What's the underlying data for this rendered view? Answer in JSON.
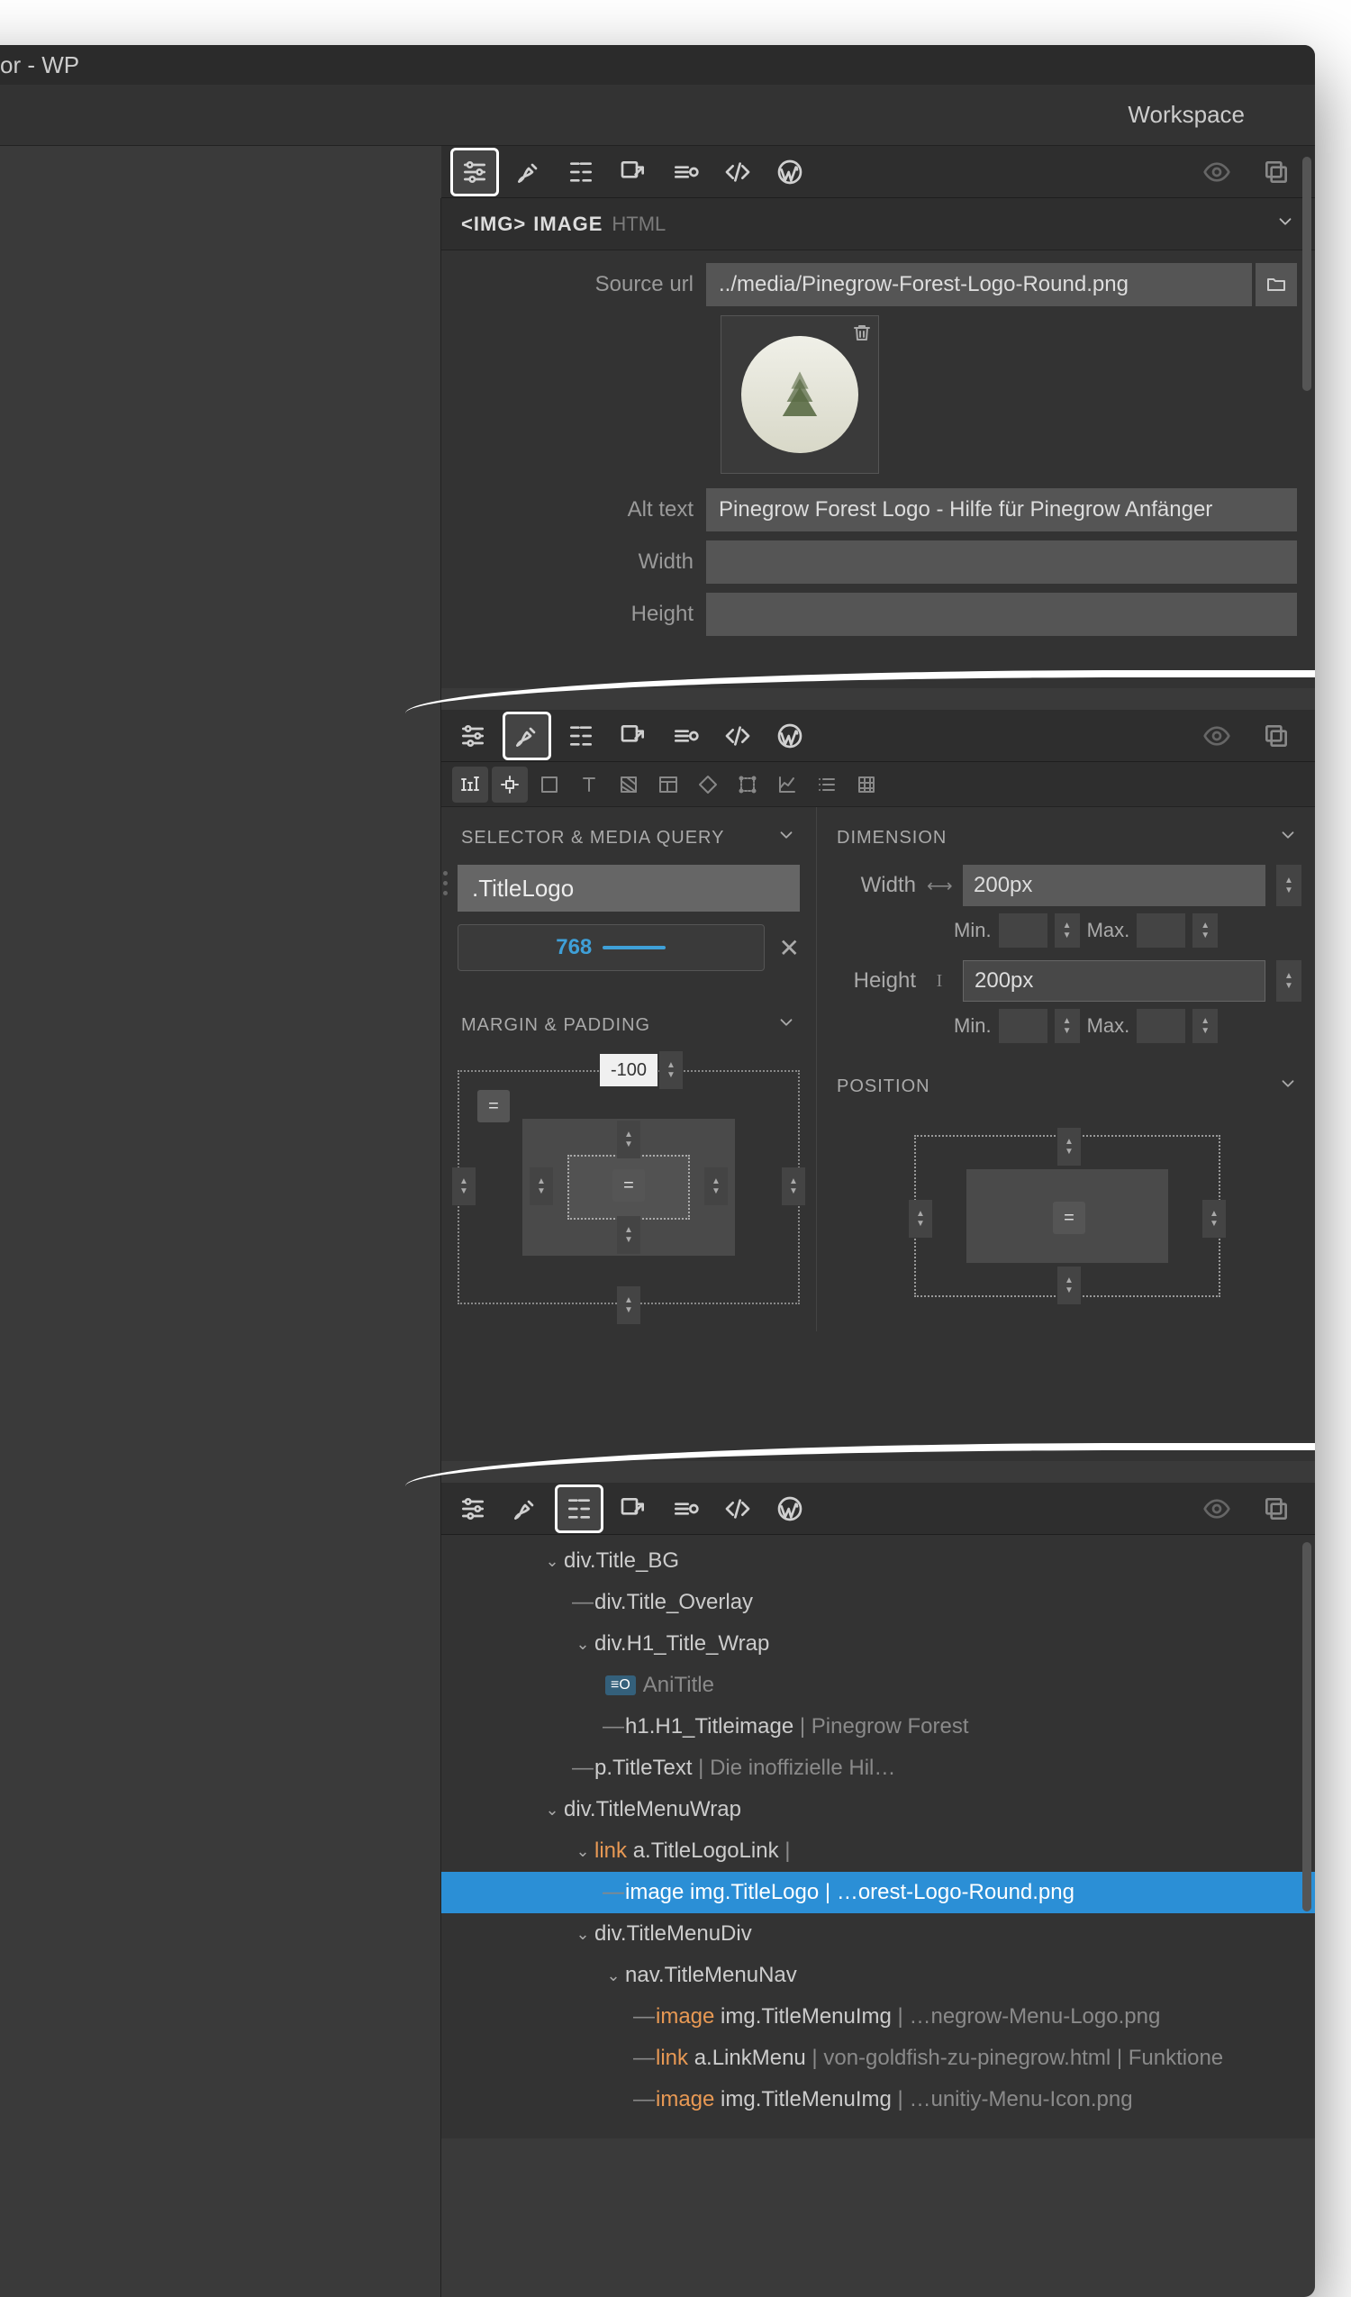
{
  "window": {
    "title_suffix": "or - WP"
  },
  "topbar": {
    "workspace": "Workspace"
  },
  "props_panel": {
    "tag": "<IMG>",
    "label": "IMAGE",
    "html_label": "HTML",
    "fields": {
      "source_url_label": "Source url",
      "source_url_value": "../media/Pinegrow-Forest-Logo-Round.png",
      "alt_text_label": "Alt text",
      "alt_text_value": "Pinegrow Forest Logo - Hilfe für Pinegrow Anfänger",
      "width_label": "Width",
      "width_value": "",
      "height_label": "Height",
      "height_value": ""
    }
  },
  "style_panel": {
    "selector_title": "SELECTOR & MEDIA QUERY",
    "selector_value": ".TitleLogo",
    "media_query": "768",
    "margin_padding_title": "MARGIN & PADDING",
    "margin_top": "-100",
    "dimension": {
      "title": "DIMENSION",
      "width_label": "Width",
      "width_value": "200px",
      "height_label": "Height",
      "height_value": "200px",
      "min_label": "Min.",
      "max_label": "Max."
    },
    "position_title": "POSITION"
  },
  "tree": {
    "r0": {
      "name": "div.Title_BG"
    },
    "r1": {
      "name": "div.Title_Overlay"
    },
    "r2": {
      "name": "div.H1_Title_Wrap"
    },
    "r3": {
      "badge": "≡O",
      "name": "AniTitle"
    },
    "r4": {
      "name": "h1.H1_Titleimage",
      "extra": "Pinegrow Forest"
    },
    "r5": {
      "name": "p.TitleText",
      "extra": "Die inoffizielle Hil…"
    },
    "r6": {
      "name": "div.TitleMenuWrap"
    },
    "r7": {
      "kind": "link",
      "name": "a.TitleLogoLink",
      "extra": ""
    },
    "r8": {
      "kind": "image",
      "name": "img.TitleLogo",
      "extra": "…orest-Logo-Round.png"
    },
    "r9": {
      "name": "div.TitleMenuDiv"
    },
    "r10": {
      "name": "nav.TitleMenuNav"
    },
    "r11": {
      "kind": "image",
      "name": "img.TitleMenuImg",
      "extra": "…negrow-Menu-Logo.png"
    },
    "r12": {
      "kind": "link",
      "name": "a.LinkMenu",
      "extra_a": "von-goldfish-zu-pinegrow.html",
      "extra_b": "Funktione"
    },
    "r13": {
      "kind": "image",
      "name": "img.TitleMenuImg",
      "extra": "…unitiy-Menu-Icon.png"
    }
  }
}
